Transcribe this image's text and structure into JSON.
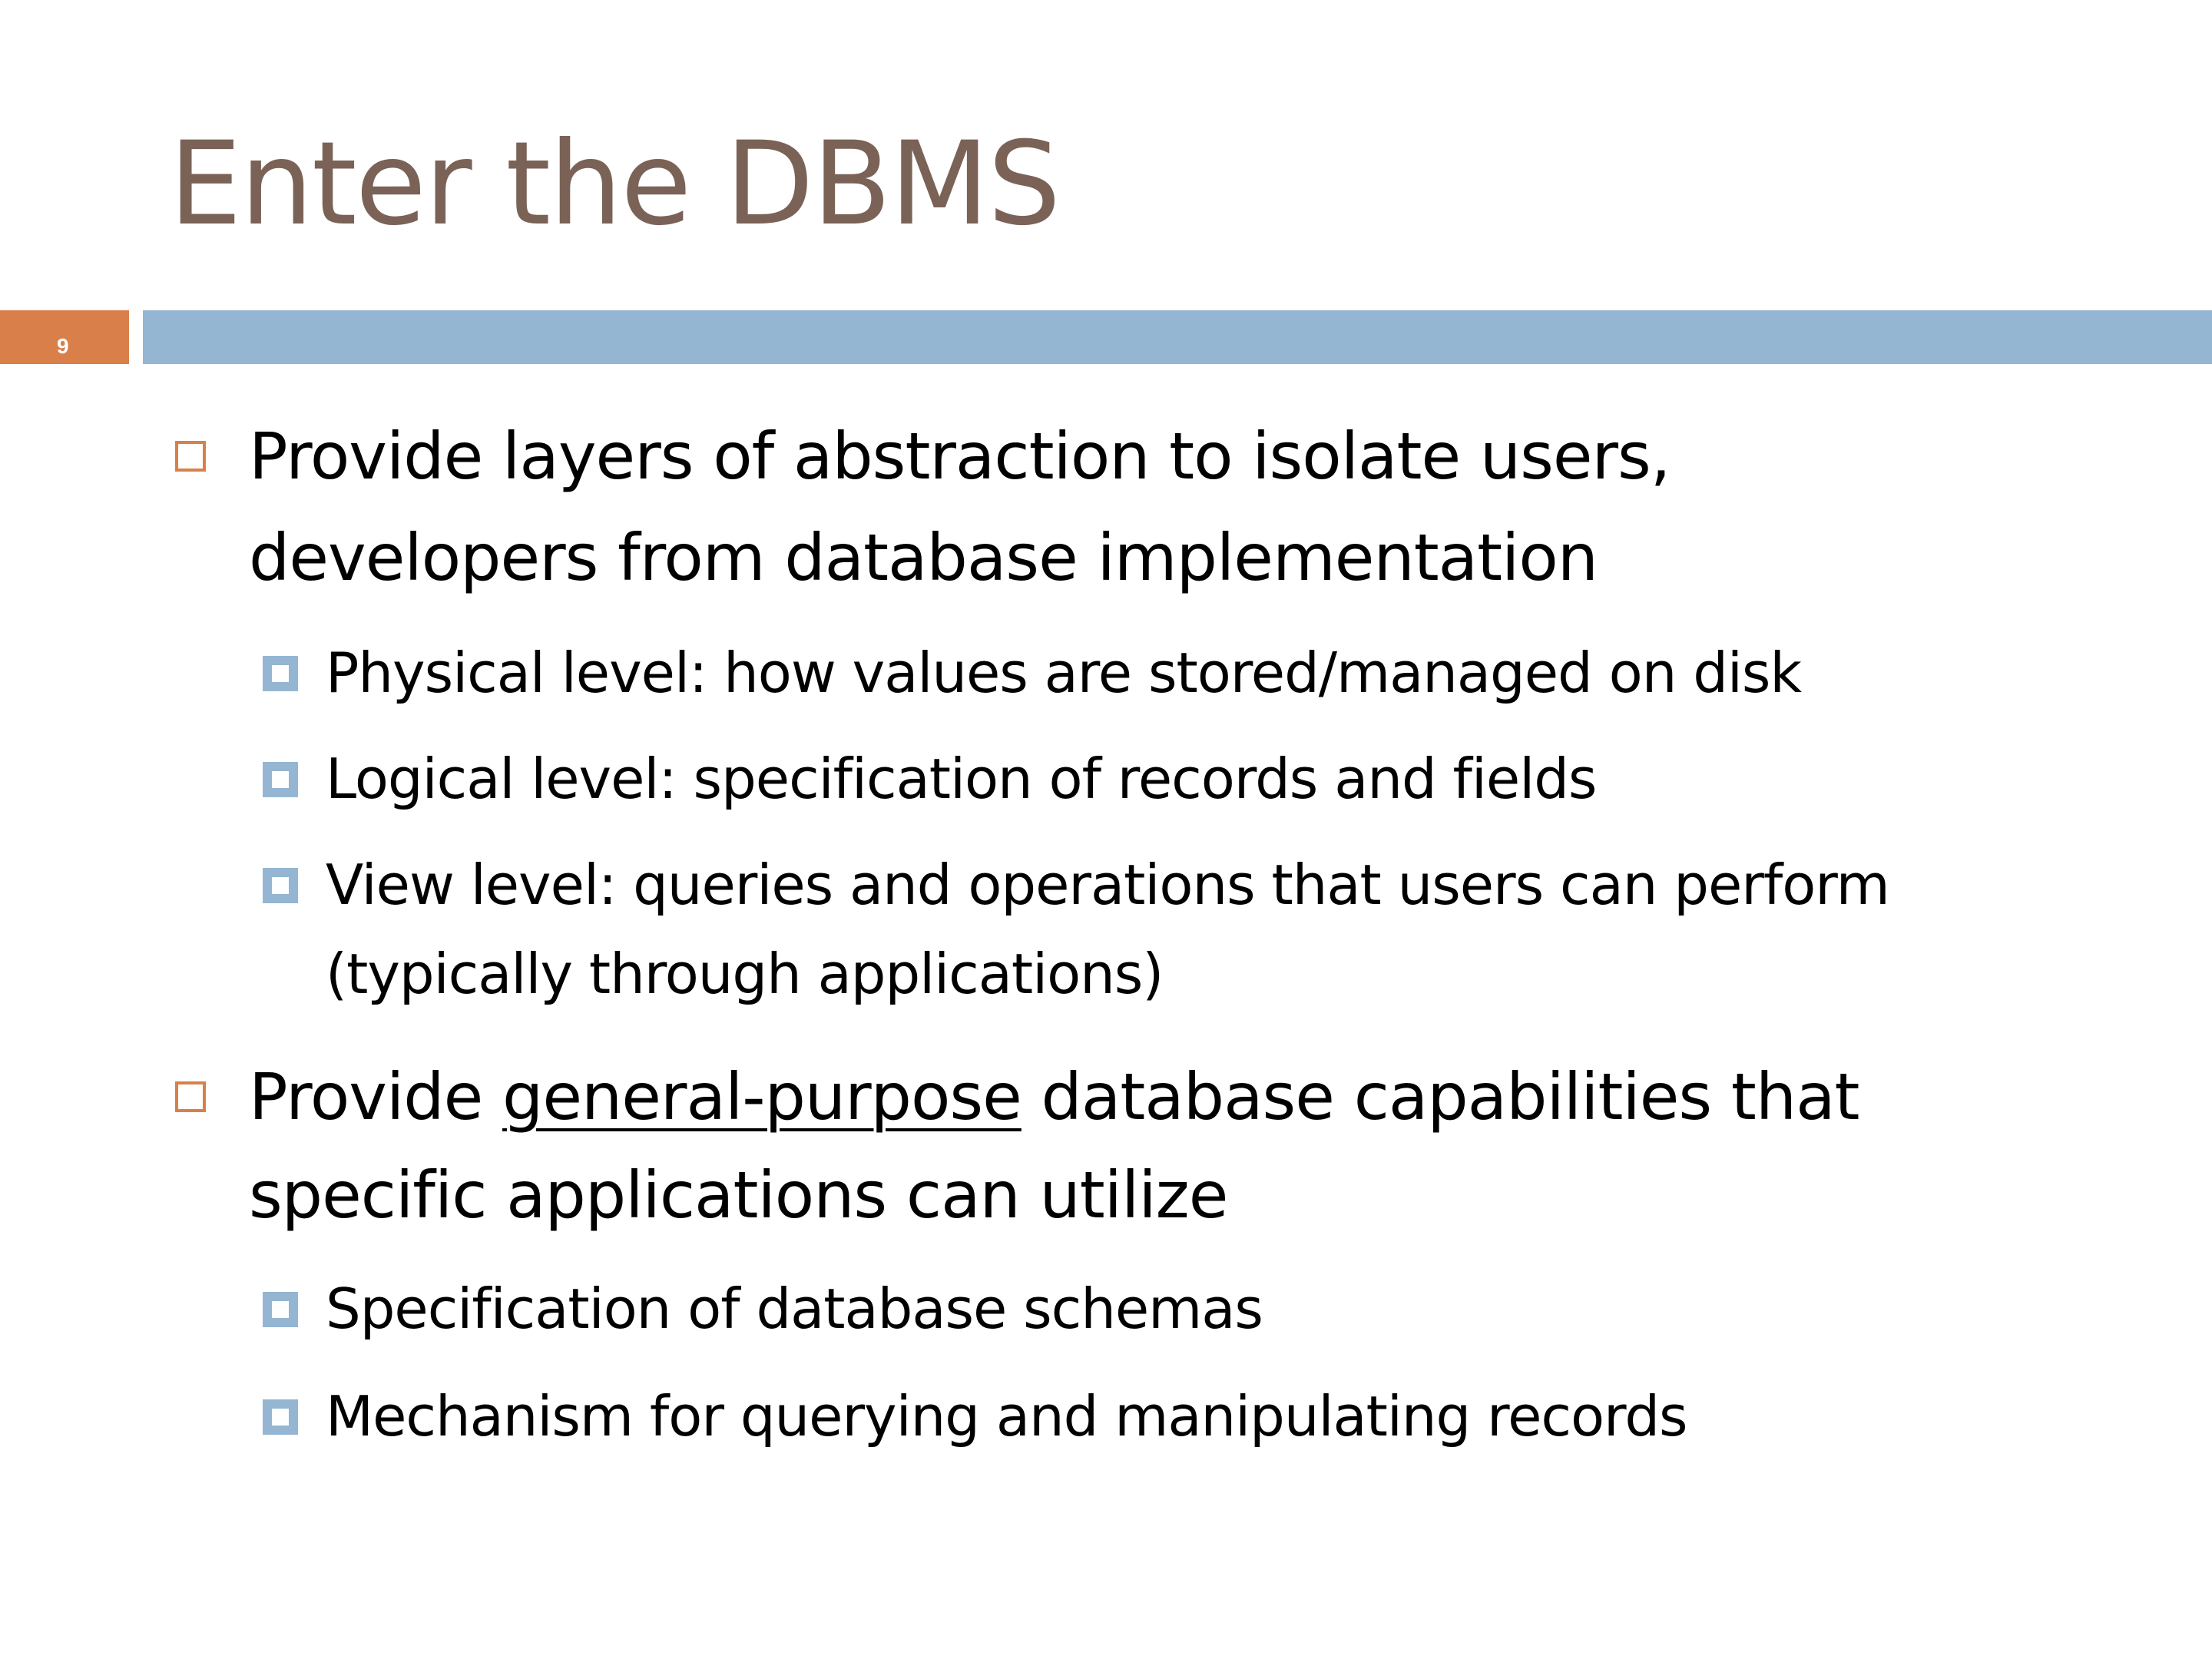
{
  "slide": {
    "title": "Enter the DBMS",
    "number": "9",
    "colors": {
      "title": "#7b6257",
      "accent_orange": "#d9804a",
      "accent_blue": "#94b6d2"
    },
    "bullets": [
      {
        "line1": "Provide layers of abstraction to isolate users,",
        "line2": "developers from database implementation",
        "sub": [
          {
            "line1": "Physical level:  how values are stored/managed on disk"
          },
          {
            "line1": "Logical level:  specification of records and fields"
          },
          {
            "line1": "View level:  queries and operations that users can perform",
            "line2": "(typically through applications)"
          }
        ]
      },
      {
        "line1_pre": "Provide ",
        "line1_underlined": "general-purpose",
        "line1_post": " database capabilities that",
        "line2": "specific applications can utilize",
        "sub": [
          {
            "line1": "Specification of database schemas"
          },
          {
            "line1": "Mechanism for querying and manipulating records"
          }
        ]
      }
    ]
  }
}
